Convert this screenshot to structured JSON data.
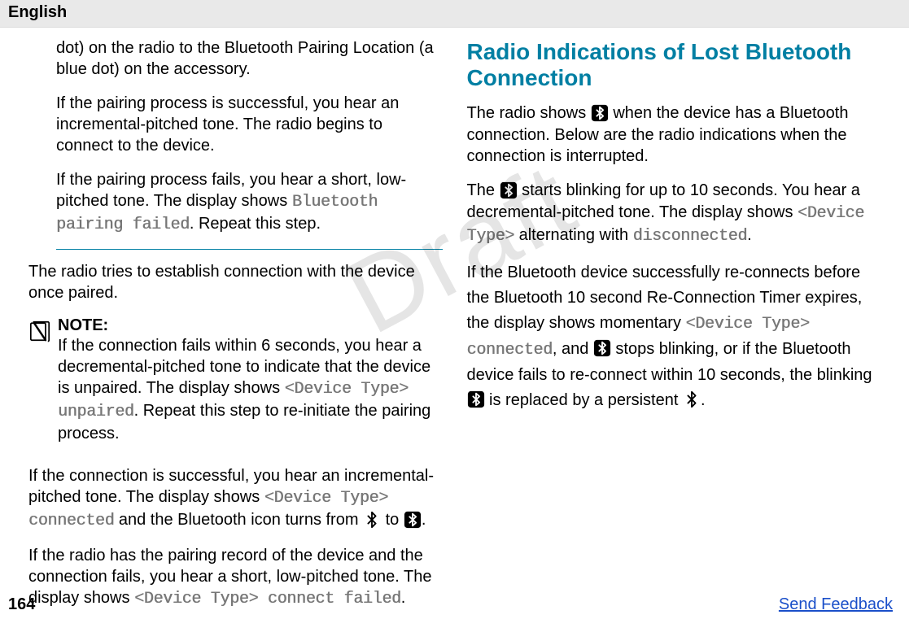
{
  "header": {
    "lang": "English"
  },
  "watermark": "Draft",
  "left": {
    "p1": "dot) on the radio to the Bluetooth Pairing Location (a blue dot) on the accessory.",
    "p2": "If the pairing process is successful, you hear an incremental-pitched tone. The radio begins to connect to the device.",
    "p3a": "If the pairing process fails, you hear a short, low-pitched tone. The display shows ",
    "p3b": ". Repeat this step.",
    "code_bt_pair_fail": "Bluetooth pairing failed",
    "p4": "The radio tries to establish connection with the device once paired.",
    "note_title": "NOTE:",
    "note_a": "If the connection fails within 6 seconds, you hear a decremental-pitched tone to indicate that the device is unpaired. The display shows ",
    "note_code": "<Device Type> unpaired",
    "note_b": ". Repeat this step to re-initiate the pairing process.",
    "p5a": "If the connection is successful, you hear an incremental-pitched tone. The display shows ",
    "p5code": "<Device Type> connected",
    "p5b": " and the Bluetooth icon turns from ",
    "p5c": " to ",
    "p5d": ".",
    "p6a": "If the radio has the pairing record of the device and the connection fails, you hear a short, low-pitched tone. The display shows ",
    "p6code": "<Device Type> connect failed",
    "p6b": "."
  },
  "right": {
    "heading": "Radio Indications of Lost Bluetooth Connection",
    "p1a": "The radio shows ",
    "p1b": " when the device has a Bluetooth connection. Below are the radio indications when the connection is interrupted.",
    "p2a": "The ",
    "p2b": " starts blinking for up to 10 seconds. You hear a decremental-pitched tone. The display shows ",
    "p2code1": "<Device Type>",
    "p2c": " alternating with ",
    "p2code2": "disconnected",
    "p2d": ".",
    "p3a": "If the Bluetooth device successfully re-connects before the Bluetooth 10 second Re-Connection Timer expires, the display shows momentary ",
    "p3code": "<Device Type> connected",
    "p3b": ", and ",
    "p3c": " stops blinking, or if the Bluetooth device fails to re-connect within 10 seconds, the blinking ",
    "p3d": " is replaced by a persistent ",
    "p3e": "."
  },
  "footer": {
    "page": "164",
    "feedback": "Send Feedback"
  }
}
